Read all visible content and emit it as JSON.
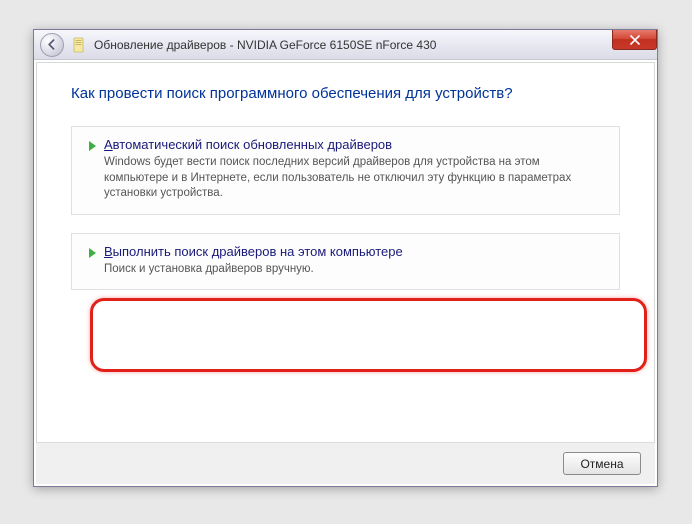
{
  "titlebar": {
    "title": "Обновление драйверов - NVIDIA GeForce 6150SE nForce 430"
  },
  "heading": "Как провести поиск программного обеспечения для устройств?",
  "options": [
    {
      "title_prefix": "А",
      "title_rest": "втоматический поиск обновленных драйверов",
      "desc": "Windows будет вести поиск последних версий драйверов для устройства на этом компьютере и в Интернете, если пользователь не отключил эту функцию в параметрах установки устройства."
    },
    {
      "title_prefix": "В",
      "title_rest": "ыполнить поиск драйверов на этом компьютере",
      "desc": "Поиск и установка драйверов вручную."
    }
  ],
  "footer": {
    "cancel": "Отмена"
  }
}
